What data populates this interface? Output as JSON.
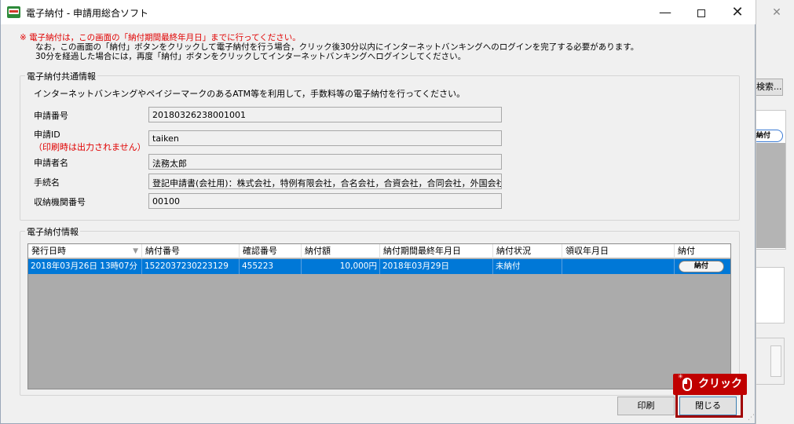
{
  "background_window": {
    "search_label": "検索...",
    "pay_label": "納付",
    "close_glyph": "✕"
  },
  "window": {
    "title": "電子納付 - 申請用総合ソフト",
    "minimize_glyph": "—",
    "close_glyph": "✕"
  },
  "notice": {
    "line1": "※  電子納付は，この画面の「納付期間最終年月日」までに行ってください。",
    "line2": "なお，この画面の「納付」ボタンをクリックして電子納付を行う場合，クリック後30分以内にインターネットバンキングへのログインを完了する必要があります。",
    "line3": "30分を経過した場合には，再度「納付」ボタンをクリックしてインターネットバンキングへログインしてください。"
  },
  "common_info": {
    "legend": "電子納付共通情報",
    "description": "インターネットバンキングやペイジーマークのあるATM等を利用して，手数料等の電子納付を行ってください。",
    "fields": [
      {
        "label": "申請番号",
        "value": "20180326238001001"
      },
      {
        "label": "申請ID",
        "sublabel": "（印刷時は出力されません）",
        "value": "taiken"
      },
      {
        "label": "申請者名",
        "value": "法務太郎"
      },
      {
        "label": "手続名",
        "value": "登記申請書(会社用)：株式会社，特例有限会社，合名会社，合資会社，合同会社，外国会社等"
      },
      {
        "label": "収納機関番号",
        "value": "00100"
      }
    ]
  },
  "payment_info": {
    "legend": "電子納付情報",
    "columns": [
      "発行日時",
      "納付番号",
      "確認番号",
      "納付額",
      "納付期間最終年月日",
      "納付状況",
      "領収年月日",
      "納付"
    ],
    "sort_glyph": "▼",
    "rows": [
      {
        "issued": "2018年03月26日 13時07分",
        "payment_no": "1522037230223129",
        "confirm_no": "455223",
        "amount": "10,000円",
        "deadline": "2018年03月29日",
        "status": "未納付",
        "receipt_date": "",
        "pay_button": "納付"
      }
    ]
  },
  "buttons": {
    "print": "印刷",
    "close": "閉じる"
  },
  "callout": {
    "label": "クリック",
    "color": "#c00000"
  },
  "colors": {
    "selection": "#0078d7",
    "notice_red": "#e00000",
    "grid_empty": "#ababab"
  }
}
